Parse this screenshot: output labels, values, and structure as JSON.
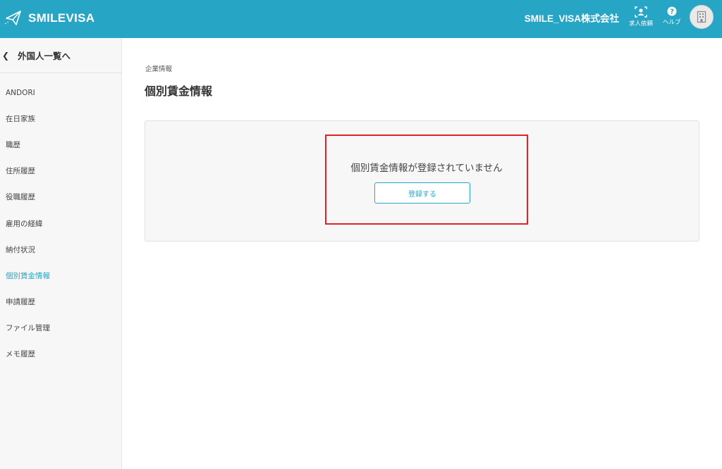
{
  "header": {
    "logo_text": "SMILEVISA",
    "company_name": "SMILE_VISA株式会社",
    "job_request_label": "求人依頼",
    "help_label": "ヘルプ",
    "accent_color": "#27a5c5"
  },
  "sidebar": {
    "back_label": "外国人一覧へ",
    "items": [
      {
        "label": "ANDORI",
        "active": false
      },
      {
        "label": "在日家族",
        "active": false
      },
      {
        "label": "職歴",
        "active": false
      },
      {
        "label": "住所履歴",
        "active": false
      },
      {
        "label": "役職履歴",
        "active": false
      },
      {
        "label": "雇用の経緯",
        "active": false
      },
      {
        "label": "納付状況",
        "active": false
      },
      {
        "label": "個別賃金情報",
        "active": true
      },
      {
        "label": "申請履歴",
        "active": false
      },
      {
        "label": "ファイル管理",
        "active": false
      },
      {
        "label": "メモ履歴",
        "active": false
      }
    ]
  },
  "main": {
    "breadcrumb": "企業情報",
    "title": "個別賃金情報",
    "empty_message": "個別賃金情報が登録されていません",
    "register_label": "登録する",
    "highlight_color": "#e0202b"
  }
}
